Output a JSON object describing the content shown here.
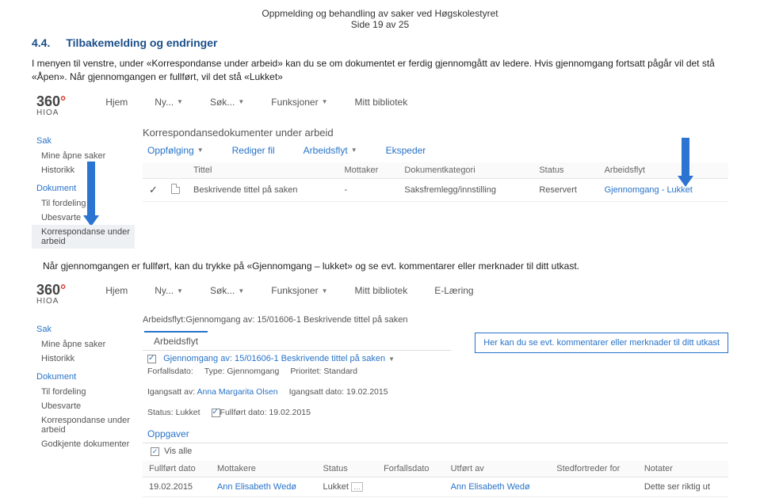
{
  "doc": {
    "title": "Oppmelding og behandling av saker ved Høgskolestyret",
    "page_line": "Side 19 av 25",
    "section_num": "4.4.",
    "section_title": "Tilbakemelding og endringer",
    "para1": "I menyen til venstre, under «Korrespondanse under arbeid» kan du se om dokumentet er ferdig gjennomgått av ledere. Hvis gjennomgang fortsatt pågår vil det stå «Åpen». Når gjennomgangen er fullført, vil det stå «Lukket»",
    "para2": "Når gjennomgangen er fullført, kan du trykke på «Gjennomgang – lukket» og se evt. kommentarer eller merknader til ditt utkast.",
    "page_num": "19"
  },
  "shot1": {
    "menu": [
      "Hjem",
      "Ny...",
      "Søk...",
      "Funksjoner",
      "Mitt bibliotek"
    ],
    "crumb": "Korrespondansedokumenter under arbeid",
    "sidebar": {
      "groups": [
        {
          "head": "Sak",
          "items": [
            "Mine åpne saker",
            "Historikk"
          ]
        },
        {
          "head": "Dokument",
          "items": [
            "Til fordeling",
            "Ubesvarte",
            "Korrespondanse under arbeid"
          ]
        }
      ],
      "selected": "Korrespondanse under arbeid"
    },
    "toolbar": [
      "Oppfølging",
      "Rediger fil",
      "Arbeidsflyt",
      "Ekspeder"
    ],
    "columns": [
      "",
      "",
      "Tittel",
      "Mottaker",
      "Dokumentkategori",
      "Status",
      "Arbeidsflyt"
    ],
    "row": {
      "tittel": "Beskrivende tittel på saken",
      "mottaker": "-",
      "kategori": "Saksfremlegg/innstilling",
      "status": "Reservert",
      "flyt": "Gjennomgang - Lukket"
    }
  },
  "shot2": {
    "menu": [
      "Hjem",
      "Ny...",
      "Søk...",
      "Funksjoner",
      "Mitt bibliotek",
      "E-Læring"
    ],
    "crumb": "Arbeidsflyt:Gjennomgang av: 15/01606-1 Beskrivende tittel på saken",
    "sidebar": {
      "groups": [
        {
          "head": "Sak",
          "items": [
            "Mine åpne saker",
            "Historikk"
          ]
        },
        {
          "head": "Dokument",
          "items": [
            "Til fordeling",
            "Ubesvarte",
            "Korrespondanse under arbeid",
            "Godkjente dokumenter"
          ]
        }
      ]
    },
    "tab": "Arbeidsflyt",
    "link": "Gjennomgang av: 15/01606-1 Beskrivende tittel på saken",
    "meta": {
      "forfall_label": "Forfallsdato:",
      "type_label": "Type:",
      "type": "Gjennomgang",
      "prioritet_label": "Prioritet:",
      "prioritet": "Standard",
      "igangsatt_label": "Igangsatt av:",
      "igangsatt_av": "Anna Margarita Olsen",
      "igdato_label": "Igangsatt dato:",
      "igdato": "19.02.2015",
      "status_label": "Status:",
      "status": "Lukket",
      "fullfort_label": "Fullført dato:",
      "fullfort": "19.02.2015"
    },
    "callout": "Her kan du se evt. kommentarer eller merknader til ditt utkast",
    "oppgaver": "Oppgaver",
    "visalle": "Vis alle",
    "cols": [
      "Fullført dato",
      "Mottakere",
      "Status",
      "Forfallsdato",
      "Utført av",
      "Stedfortreder for",
      "Notater"
    ],
    "row": {
      "dato": "19.02.2015",
      "mottaker": "Ann Elisabeth Wedø",
      "status": "Lukket",
      "forfall": "",
      "utfort": "Ann Elisabeth Wedø",
      "sted": "",
      "notat": "Dette ser riktig ut"
    }
  },
  "logo": {
    "brand": "360",
    "sub": "HIOA"
  }
}
